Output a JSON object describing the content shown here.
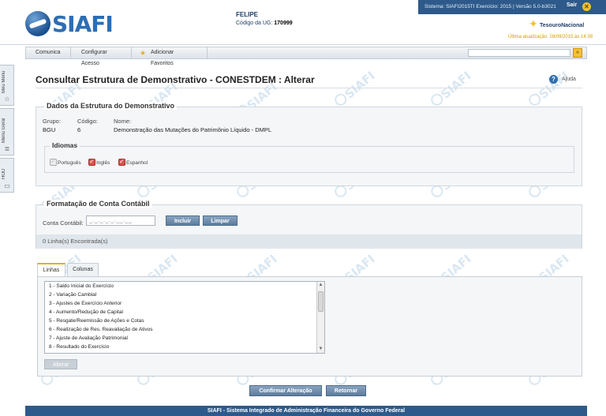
{
  "header": {
    "logo_text": "SIAFI",
    "user_name": "FELIPE",
    "ug_label": "Código da UG:",
    "ug_value": "170999",
    "system_info": "Sistema: SIAFI2015TI Exercício: 2015 | Versão 5.0-b3021",
    "exit_label": "Sair",
    "exit_icon": "close-icon",
    "org_name": "TesouroNacional",
    "last_update": "Última atualização: 28/09/2015 às 14:38"
  },
  "menu": {
    "items": [
      "Comunica",
      "Configurar Acesso",
      "Adicionar Favoritos"
    ],
    "search_placeholder": "",
    "go_label": "»"
  },
  "side_tabs": [
    "Meu Menu",
    "Menu Geral",
    "HOD"
  ],
  "page": {
    "title": "Consultar Estrutura de Demonstrativo - CONESTDEM : Alterar",
    "help_label": "Ajuda"
  },
  "dados": {
    "title": "Dados da Estrutura do Demonstrativo",
    "grupo_label": "Grupo:",
    "grupo_value": "BGU",
    "codigo_label": "Código:",
    "codigo_value": "6",
    "nome_label": "Nome:",
    "nome_value": "Demonstração das Mutações do Patrimônio Líquido - DMPL",
    "idiomas": {
      "title": "Idiomas",
      "options": [
        {
          "label": "Português",
          "checked": true,
          "disabled": true
        },
        {
          "label": "Inglês",
          "checked": true,
          "disabled": false
        },
        {
          "label": "Espanhol",
          "checked": true,
          "disabled": false
        }
      ]
    }
  },
  "formatacao": {
    "title": "Formatação de Conta Contábil",
    "conta_label": "Conta Contábil:",
    "conta_mask": "_._._._._.__.__",
    "incluir_label": "Incluir",
    "limpar_label": "Limpar",
    "count_text": "0 Linha(s) Encontrada(s)"
  },
  "tabs": {
    "items": [
      "Linhas",
      "Colunas"
    ],
    "active": "Linhas"
  },
  "linhas": {
    "items": [
      "1 - Saldo Inicial do Exercício",
      "2 - Variação Cambial",
      "3 - Ajustes de Exercício Anterior",
      "4 - Aumento/Redução de Capital",
      "5 - Resgate/Reemissão de Ações e Cotas",
      "6 - Realização de Res. Reavaliação de Ativos",
      "7 - Ajuste de Avaliação Patrimonial",
      "8 - Resultado do Exercício"
    ],
    "alterar_label": "Alterar"
  },
  "actions": {
    "confirmar_label": "Confirmar Alteração",
    "retornar_label": "Retornar"
  },
  "footer": {
    "text": "SIAFI - Sistema Integrado de Administração Financeira do Governo Federal"
  },
  "watermark_text": "SIAFI",
  "colors": {
    "brand_blue": "#2d6eb3",
    "dark_blue": "#2d5a8a",
    "button": "#5c7c9e",
    "accent_yellow": "#f2c230",
    "checkbox_red": "#d9534f"
  }
}
